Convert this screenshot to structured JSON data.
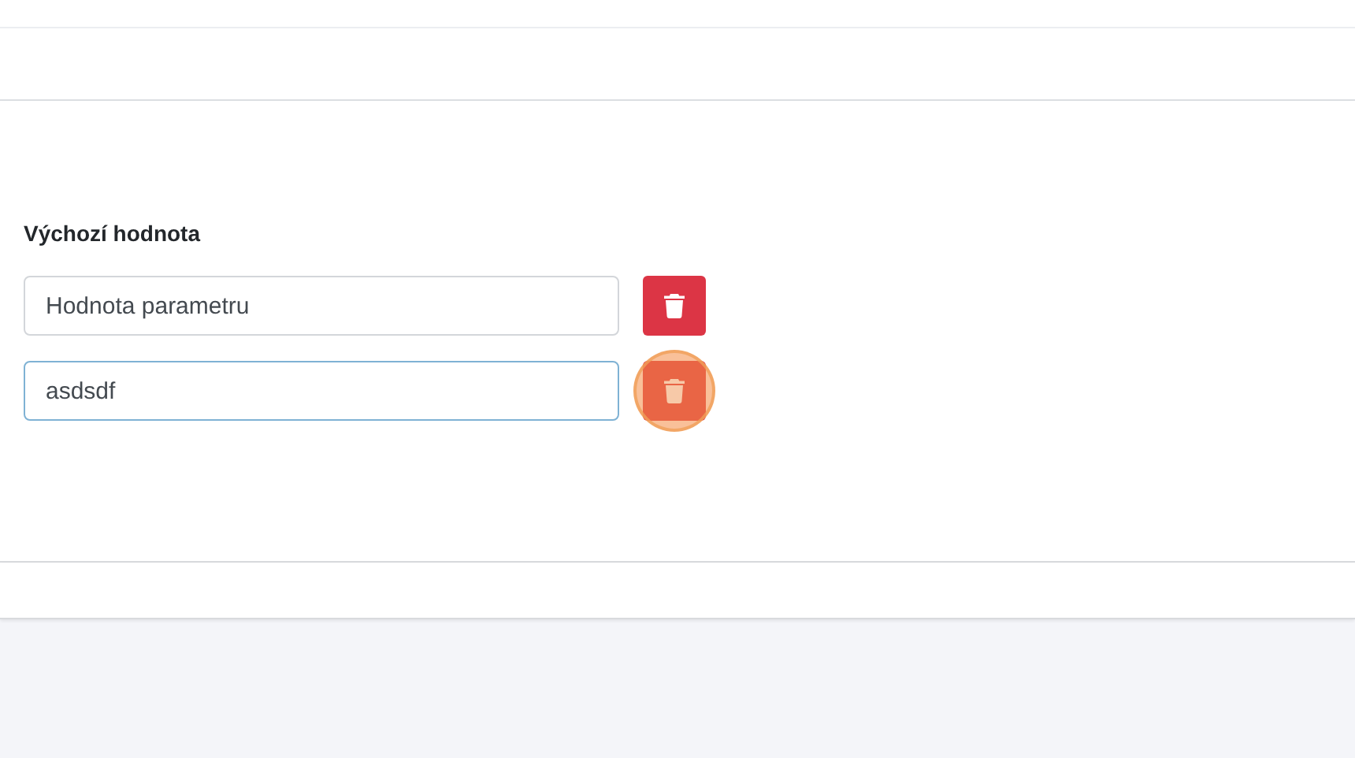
{
  "field_label": "Výchozí hodnota",
  "rows": [
    {
      "value": "Hodnota parametru",
      "focused": false,
      "click_marker": false
    },
    {
      "value": "asdsdf",
      "focused": true,
      "click_marker": true
    }
  ]
}
